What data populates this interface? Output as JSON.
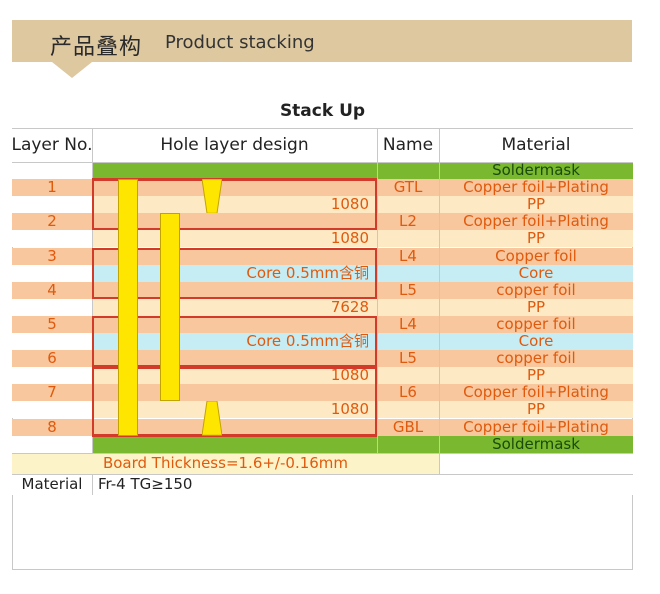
{
  "banner": {
    "title_cn": "产品叠构",
    "title_en": "Product stacking"
  },
  "table": {
    "title": "Stack Up",
    "headers": {
      "layer_no": "Layer No.",
      "hole": "Hole layer design",
      "name": "Name",
      "material": "Material"
    },
    "rows": [
      {
        "layer": "",
        "hole": "",
        "name": "",
        "material": "Soldermask",
        "type": "green"
      },
      {
        "layer": "1",
        "hole": "",
        "name": "GTL",
        "material": "Copper foil+Plating",
        "type": "cu"
      },
      {
        "layer": "",
        "hole": "1080",
        "name": "",
        "material": "PP",
        "type": "pp"
      },
      {
        "layer": "2",
        "hole": "",
        "name": "L2",
        "material": "Copper foil+Plating",
        "type": "cu"
      },
      {
        "layer": "",
        "hole": "1080",
        "name": "",
        "material": "PP",
        "type": "pp"
      },
      {
        "layer": "3",
        "hole": "",
        "name": "L4",
        "material": "Copper foil",
        "type": "cu"
      },
      {
        "layer": "",
        "hole": "Core 0.5mm含铜",
        "name": "",
        "material": "Core",
        "type": "core"
      },
      {
        "layer": "4",
        "hole": "",
        "name": "L5",
        "material": "copper foil",
        "type": "cu"
      },
      {
        "layer": "",
        "hole": "7628",
        "name": "",
        "material": "PP",
        "type": "pp"
      },
      {
        "layer": "5",
        "hole": "",
        "name": "L4",
        "material": "copper foil",
        "type": "cu"
      },
      {
        "layer": "",
        "hole": "Core 0.5mm含铜",
        "name": "",
        "material": "Core",
        "type": "core"
      },
      {
        "layer": "6",
        "hole": "",
        "name": "L5",
        "material": "copper foil",
        "type": "cu"
      },
      {
        "layer": "",
        "hole": "1080",
        "name": "",
        "material": "PP",
        "type": "pp"
      },
      {
        "layer": "7",
        "hole": "",
        "name": "L6",
        "material": "Copper foil+Plating",
        "type": "cu"
      },
      {
        "layer": "",
        "hole": "1080",
        "name": "",
        "material": "PP",
        "type": "pp"
      },
      {
        "layer": "8",
        "hole": "",
        "name": "GBL",
        "material": "Copper foil+Plating",
        "type": "cu"
      },
      {
        "layer": "",
        "hole": "",
        "name": "",
        "material": "Soldermask",
        "type": "green"
      }
    ],
    "thickness": "Board Thickness=1.6+/-0.16mm",
    "material_label": "Material",
    "material_value": "Fr-4   TG≥150"
  },
  "colors": {
    "soldermask": "#7ab82f",
    "copper": "#f8c79d",
    "prepreg": "#fde9c3",
    "core": "#c6ecf4",
    "via": "#ffe600",
    "frame": "#d23a2a",
    "text": "#e05a0e"
  }
}
